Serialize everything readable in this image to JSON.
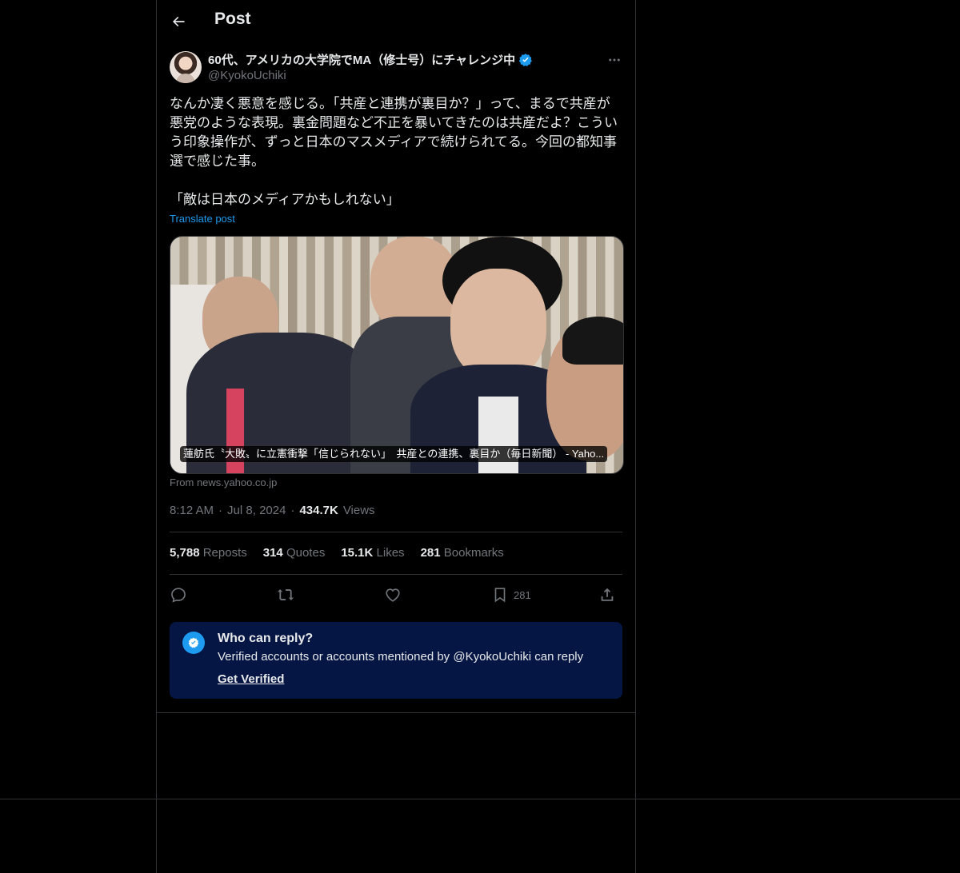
{
  "header": {
    "title": "Post"
  },
  "author": {
    "display_name": "60代、アメリカの大学院でMA（修士号）にチャレンジ中",
    "handle": "@KyokoUchiki",
    "verified": true
  },
  "post": {
    "text": "なんか凄く悪意を感じる。「共産と連携が裏目か？」って、まるで共産が悪党のような表現。裏金問題など不正を暴いてきたのは共産だよ？こういう印象操作が、ずっと日本のマスメディアで続けられてる。今回の都知事選で感じた事。\n\n「敵は日本のメディアかもしれない」",
    "translate_label": "Translate post",
    "card_caption": "蓮舫氏〝大敗〟に立憲衝撃「信じられない」　共産との連携、裏目か（毎日新聞） - Yaho...",
    "card_source": "From news.yahoo.co.jp",
    "time": "8:12 AM",
    "date": "Jul 8, 2024",
    "views_count": "434.7K",
    "views_label": "Views"
  },
  "stats": {
    "reposts_count": "5,788",
    "reposts_label": "Reposts",
    "quotes_count": "314",
    "quotes_label": "Quotes",
    "likes_count": "15.1K",
    "likes_label": "Likes",
    "bookmarks_count": "281",
    "bookmarks_label": "Bookmarks"
  },
  "actions": {
    "bookmark_count": "281"
  },
  "reply_restriction": {
    "title": "Who can reply?",
    "text": "Verified accounts or accounts mentioned by @KyokoUchiki can reply",
    "link": "Get Verified"
  },
  "colors": {
    "accent": "#1d9bf0",
    "background": "#000000",
    "reply_box": "#061644",
    "muted": "#71767b"
  },
  "icons": [
    "back-arrow-icon",
    "verified-badge-icon",
    "more-icon",
    "reply-icon",
    "repost-icon",
    "like-icon",
    "bookmark-icon",
    "share-icon",
    "verified-check-icon"
  ]
}
